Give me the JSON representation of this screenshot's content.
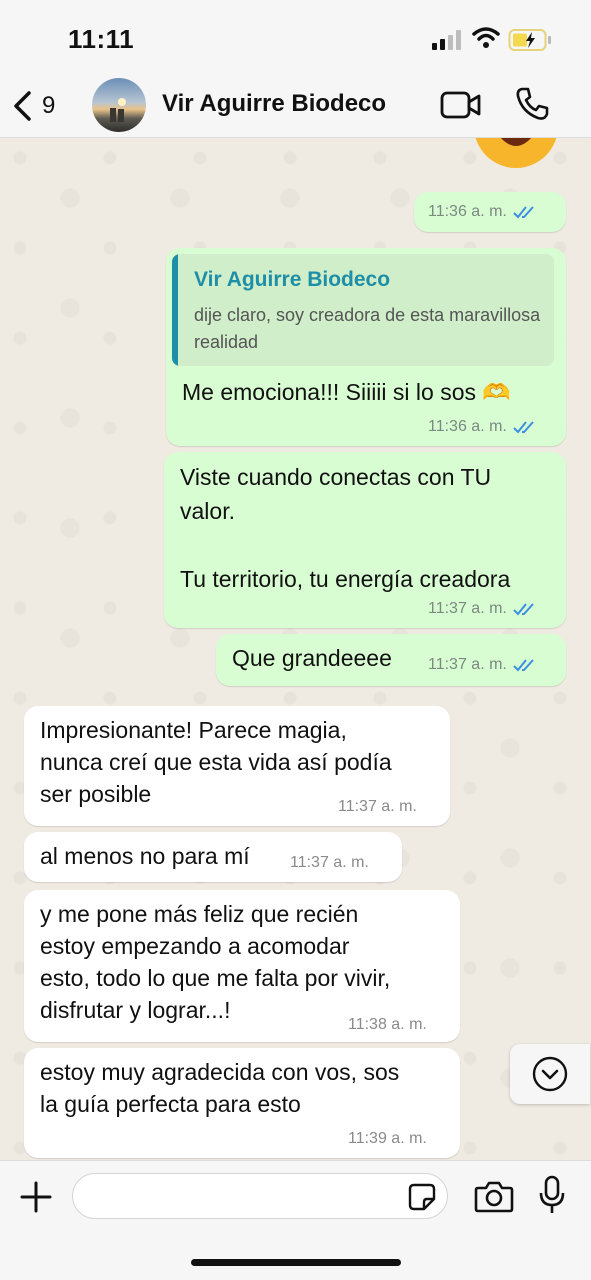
{
  "status_bar": {
    "time": "11:11"
  },
  "header": {
    "back_count": "9",
    "contact_name": "Vir Aguirre Biodeco"
  },
  "messages": [
    {
      "dir": "out",
      "time": "11:36 a. m."
    },
    {
      "dir": "out",
      "quote_author": "Vir Aguirre Biodeco",
      "quote_text": "dije claro, soy creadora de esta maravillosa realidad",
      "text": "Me emociona!!! Siiiii si lo sos 🫶",
      "time": "11:36 a. m."
    },
    {
      "dir": "out",
      "text": "Viste cuando conectas con TU\nvalor.\n\nTu territorio, tu energía creadora",
      "time": "11:37 a. m."
    },
    {
      "dir": "out",
      "text": "Que grandeeee",
      "time": "11:37 a. m."
    },
    {
      "dir": "in",
      "text": "Impresionante! Parece magia,\nnunca creí que esta vida así podía\nser posible",
      "time": "11:37 a. m."
    },
    {
      "dir": "in",
      "text": "al menos no para mí",
      "time": "11:37 a. m."
    },
    {
      "dir": "in",
      "text": "y me pone más feliz que recién\nestoy empezando a acomodar\nesto, todo lo que me falta por vivir,\ndisfrutar y lograr...!",
      "time": "11:38 a. m."
    },
    {
      "dir": "in",
      "text": "estoy muy agradecida con vos, sos\nla guía perfecta para esto",
      "time": "11:39 a. m."
    }
  ],
  "input": {
    "placeholder": ""
  },
  "colors": {
    "outgoing": "#d9fdd3",
    "incoming": "#ffffff",
    "read_ticks": "#3b8fe0",
    "quote_accent": "#1f8fa8"
  },
  "icons": [
    "back-chevron-icon",
    "video-call-icon",
    "phone-icon",
    "heart-eyes-emoji",
    "double-check-icon",
    "chevron-down-icon",
    "plus-icon",
    "sticker-icon",
    "camera-icon",
    "microphone-icon"
  ]
}
